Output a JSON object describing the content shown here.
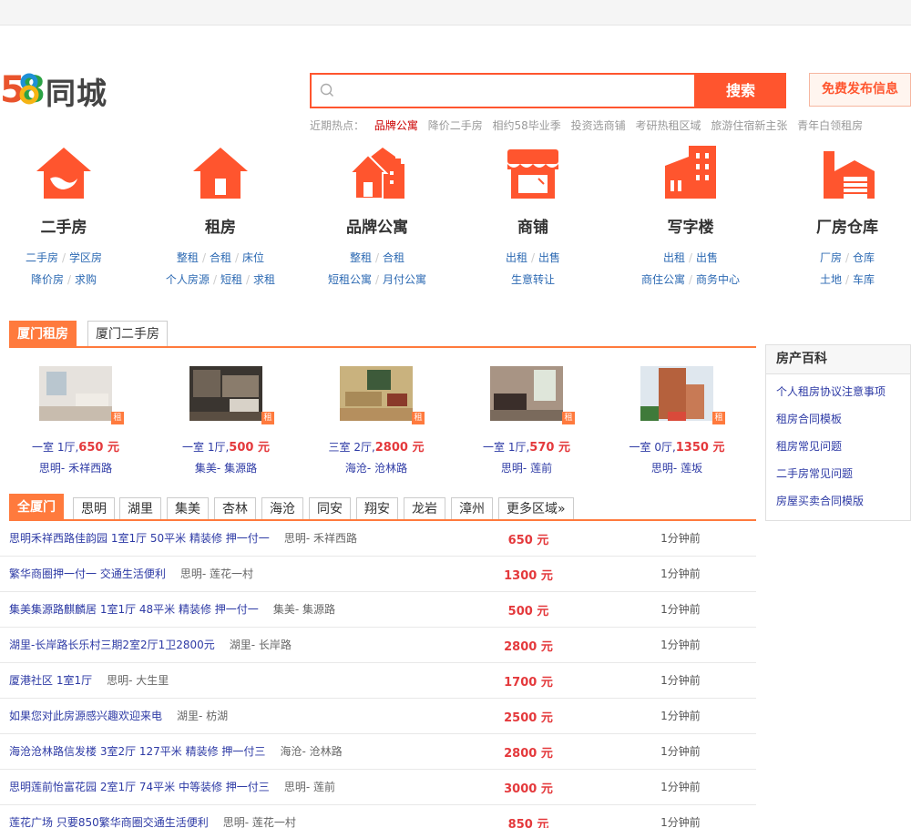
{
  "brand": {
    "logo_number": "58",
    "logo_text": "同城",
    "accent": "#ff552e"
  },
  "search": {
    "placeholder": "",
    "button_label": "搜索"
  },
  "post_button": "免费发布信息",
  "hot": {
    "label": "近期热点：",
    "items": [
      "品牌公寓",
      "降价二手房",
      "相约58毕业季",
      "投资选商铺",
      "考研热租区域",
      "旅游住宿新主张",
      "青年白领租房"
    ]
  },
  "categories": [
    {
      "title": "二手房",
      "links": [
        [
          "二手房",
          "学区房"
        ],
        [
          "降价房",
          "求购"
        ]
      ]
    },
    {
      "title": "租房",
      "links": [
        [
          "整租",
          "合租",
          "床位"
        ],
        [
          "个人房源",
          "短租",
          "求租"
        ]
      ]
    },
    {
      "title": "品牌公寓",
      "links": [
        [
          "整租",
          "合租"
        ],
        [
          "短租公寓",
          "月付公寓"
        ]
      ]
    },
    {
      "title": "商铺",
      "links": [
        [
          "出租",
          "出售"
        ],
        [
          "生意转让"
        ]
      ]
    },
    {
      "title": "写字楼",
      "links": [
        [
          "出租",
          "出售"
        ],
        [
          "商住公寓",
          "商务中心"
        ]
      ]
    },
    {
      "title": "厂房仓库",
      "links": [
        [
          "厂房",
          "仓库"
        ],
        [
          "土地",
          "车库"
        ]
      ]
    }
  ],
  "tabs": [
    "厦门租房",
    "厦门二手房"
  ],
  "rent_tag": "租",
  "featured": [
    {
      "layout": "一室 1厅,",
      "price": "650 元",
      "location": "思明- 禾祥西路",
      "photo": "#d8d4cf"
    },
    {
      "layout": "一室 1厅,",
      "price": "500 元",
      "location": "集美- 集源路",
      "photo": "#4a443f"
    },
    {
      "layout": "三室 2厅,",
      "price": "2800 元",
      "location": "海沧- 沧林路",
      "photo": "#b89868"
    },
    {
      "layout": "一室 1厅,",
      "price": "570 元",
      "location": "思明- 莲前",
      "photo": "#8a7a6a"
    },
    {
      "layout": "一室 0厅,",
      "price": "1350 元",
      "location": "思明- 莲坂",
      "photo": "#a86a4a"
    }
  ],
  "sidebar": {
    "title": "房产百科",
    "items": [
      "个人租房协议注意事项",
      "租房合同模板",
      "租房常见问题",
      "二手房常见问题",
      "房屋买卖合同模版"
    ]
  },
  "area_tabs": [
    "全厦门",
    "思明",
    "湖里",
    "集美",
    "杏林",
    "海沧",
    "同安",
    "翔安",
    "龙岩",
    "漳州",
    "更多区域»"
  ],
  "listings": [
    {
      "title": "思明禾祥西路佳韵园  1室1厅  50平米  精装修  押一付一",
      "area": "思明- 禾祥西路",
      "price": "650 元",
      "time": "1分钟前"
    },
    {
      "title": "繁华商圈押一付一  交通生活便利",
      "area": "思明- 莲花一村",
      "price": "1300 元",
      "time": "1分钟前"
    },
    {
      "title": "集美集源路麒麟居  1室1厅  48平米  精装修  押一付一",
      "area": "集美- 集源路",
      "price": "500 元",
      "time": "1分钟前"
    },
    {
      "title": "湖里-长岸路长乐村三期2室2厅1卫2800元",
      "area": "湖里- 长岸路",
      "price": "2800 元",
      "time": "1分钟前"
    },
    {
      "title": "厦港社区  1室1厅",
      "area": "思明- 大生里",
      "price": "1700 元",
      "time": "1分钟前"
    },
    {
      "title": "如果您对此房源感兴趣欢迎来电",
      "area": "湖里- 枋湖",
      "price": "2500 元",
      "time": "1分钟前"
    },
    {
      "title": "海沧沧林路信发楼  3室2厅  127平米  精装修  押一付三",
      "area": "海沧- 沧林路",
      "price": "2800 元",
      "time": "1分钟前"
    },
    {
      "title": "思明莲前怡富花园  2室1厅  74平米  中等装修  押一付三",
      "area": "思明- 莲前",
      "price": "3000 元",
      "time": "1分钟前"
    },
    {
      "title": "莲花广场  只要850繁华商圈交通生活便利",
      "area": "思明- 莲花一村",
      "price": "850 元",
      "time": "1分钟前"
    }
  ]
}
